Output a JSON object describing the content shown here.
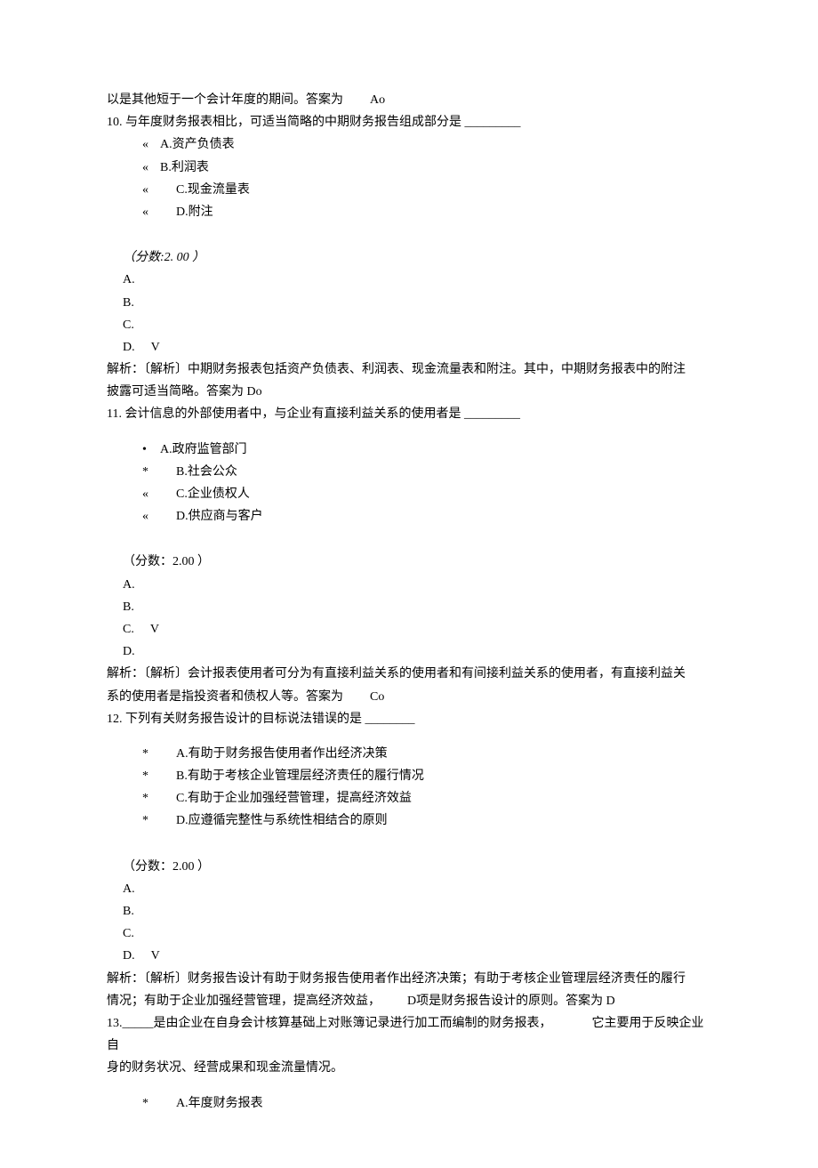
{
  "intro_tail": "以是其他短于一个会计年度的期间。答案为",
  "intro_tail_suffix": "Ao",
  "q10": {
    "number": "10.",
    "stem": "与年度财务报表相比，可适当简略的中期财务报告组成部分是",
    "blank": "_________",
    "options": {
      "A": {
        "bullet": "«",
        "text": "A.资产负债表"
      },
      "B": {
        "bullet": "«",
        "text": "B.利润表"
      },
      "C": {
        "bullet": "«",
        "text": "C.现金流量表"
      },
      "D": {
        "bullet": "«",
        "text": "D.附注"
      }
    },
    "score": "（分数:2. 00 ）",
    "answers": {
      "A": "A.",
      "B": "B.",
      "C": "C.",
      "D": "D."
    },
    "mark": "V",
    "analysis_l1": "解析：〔解析〕中期财务报表包括资产负债表、利润表、现金流量表和附注。其中，中期财务报表中的附注",
    "analysis_l2": "披露可适当简略。答案为 Do"
  },
  "q11": {
    "number": "11.",
    "stem": "会计信息的外部使用者中，与企业有直接利益关系的使用者是",
    "blank": "_________",
    "options": {
      "A": {
        "bullet": "•",
        "text": "A.政府监管部门"
      },
      "B": {
        "bullet": "*",
        "text": "B.社会公众"
      },
      "C": {
        "bullet": "«",
        "text": "C.企业债权人"
      },
      "D": {
        "bullet": "«",
        "text": "D.供应商与客户"
      }
    },
    "score": "（分数：2.00 ）",
    "answers": {
      "A": "A.",
      "B": "B.",
      "C": "C.",
      "D": "D."
    },
    "mark": "V",
    "analysis_l1": "解析：〔解析〕会计报表使用者可分为有直接利益关系的使用者和有间接利益关系的使用者，有直接利益关",
    "analysis_l2_a": "系的使用者是指投资者和债权人等。答案为",
    "analysis_l2_b": "Co"
  },
  "q12": {
    "number": "12.",
    "stem": "下列有关财务报告设计的目标说法错误的是",
    "blank": "________",
    "options": {
      "A": {
        "bullet": "*",
        "text": "A.有助于财务报告使用者作出经济决策"
      },
      "B": {
        "bullet": "*",
        "text": "B.有助于考核企业管理层经济责任的履行情况"
      },
      "C": {
        "bullet": "*",
        "text": "C.有助于企业加强经营管理，提高经济效益"
      },
      "D": {
        "bullet": "*",
        "text": "D.应遵循完整性与系统性相结合的原则"
      }
    },
    "score": "（分数：2.00 ）",
    "answers": {
      "A": "A.",
      "B": "B.",
      "C": "C.",
      "D": "D."
    },
    "mark": "V",
    "analysis_l1": "解析：〔解析〕财务报告设计有助于财务报告使用者作出经济决策；有助于考核企业管理层经济责任的履行",
    "analysis_l2_a": "情况；有助于企业加强经营管理，提高经济效益，",
    "analysis_l2_b": "D项是财务报告设计的原则。答案为 D"
  },
  "q13": {
    "number": "13.",
    "blank": "_____",
    "stem_a": "是由企业在自身会计核算基础上对账簿记录进行加工而编制的财务报表，",
    "stem_b": "它主要用于反映企业自",
    "stem_l2": "身的财务状况、经营成果和现金流量情况。",
    "options": {
      "A": {
        "bullet": "*",
        "text": "A.年度财务报表"
      }
    }
  }
}
